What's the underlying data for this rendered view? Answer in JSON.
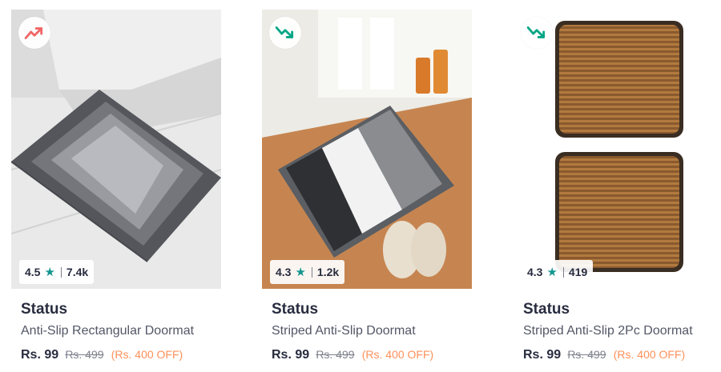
{
  "colors": {
    "trend_up": "#f16565",
    "trend_down": "#03a685",
    "star": "#14958f",
    "discount": "#ff905a"
  },
  "products": [
    {
      "trend_icon": "trending-up-icon",
      "rating": "4.5",
      "rating_count": "7.4k",
      "brand": "Status",
      "title": "Anti-Slip Rectangular Doormat",
      "price": "Rs. 99",
      "mrp": "Rs. 499",
      "discount": "(Rs. 400 OFF)"
    },
    {
      "trend_icon": "trending-down-icon",
      "rating": "4.3",
      "rating_count": "1.2k",
      "brand": "Status",
      "title": "Striped Anti-Slip Doormat",
      "price": "Rs. 99",
      "mrp": "Rs. 499",
      "discount": "(Rs. 400 OFF)"
    },
    {
      "trend_icon": "trending-down-icon",
      "rating": "4.3",
      "rating_count": "419",
      "brand": "Status",
      "title": "Striped Anti-Slip 2Pc Doormat",
      "price": "Rs. 99",
      "mrp": "Rs. 499",
      "discount": "(Rs. 400 OFF)"
    }
  ]
}
